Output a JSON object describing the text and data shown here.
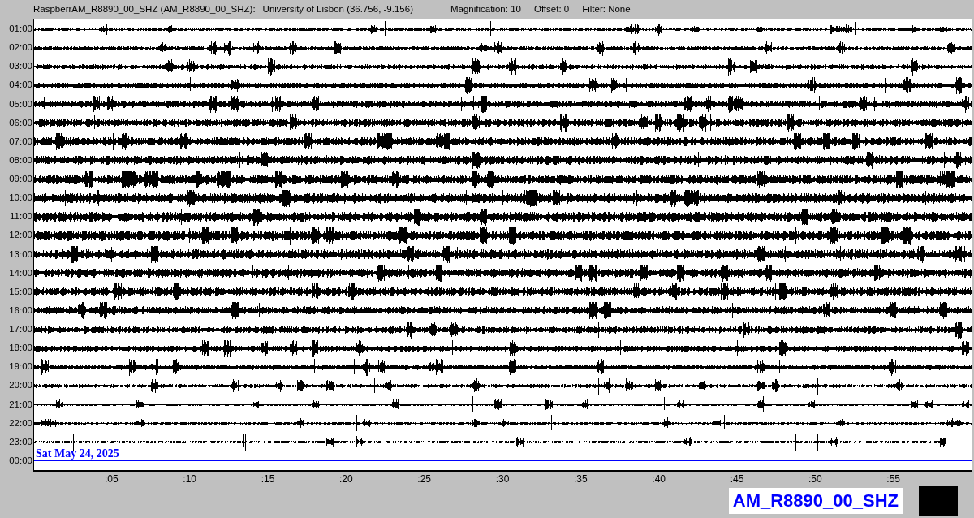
{
  "header": {
    "station": "RaspberrAM_R8890_00_SHZ (AM_R8890_00_SHZ):",
    "location": "University of Lisbon (36.756, -9.156)",
    "magnification": "Magnification: 10",
    "offset": "Offset: 0",
    "filter": "Filter: None"
  },
  "helicorder": {
    "rows": [
      {
        "time": "01:00",
        "kind": "full"
      },
      {
        "time": "02:00",
        "kind": "full"
      },
      {
        "time": "03:00",
        "kind": "full"
      },
      {
        "time": "04:00",
        "kind": "full"
      },
      {
        "time": "05:00",
        "kind": "full"
      },
      {
        "time": "06:00",
        "kind": "full"
      },
      {
        "time": "07:00",
        "kind": "full"
      },
      {
        "time": "08:00",
        "kind": "full"
      },
      {
        "time": "09:00",
        "kind": "full"
      },
      {
        "time": "10:00",
        "kind": "full"
      },
      {
        "time": "11:00",
        "kind": "full"
      },
      {
        "time": "12:00",
        "kind": "full"
      },
      {
        "time": "13:00",
        "kind": "full"
      },
      {
        "time": "14:00",
        "kind": "full"
      },
      {
        "time": "15:00",
        "kind": "full"
      },
      {
        "time": "16:00",
        "kind": "full"
      },
      {
        "time": "17:00",
        "kind": "full"
      },
      {
        "time": "18:00",
        "kind": "full"
      },
      {
        "time": "19:00",
        "kind": "full"
      },
      {
        "time": "20:00",
        "kind": "full"
      },
      {
        "time": "21:00",
        "kind": "full"
      },
      {
        "time": "22:00",
        "kind": "full"
      },
      {
        "time": "23:00",
        "kind": "partial"
      },
      {
        "time": "00:00",
        "kind": "empty"
      }
    ],
    "date_label": "Sat May 24, 2025",
    "x_ticks": [
      ":05",
      ":10",
      ":15",
      ":20",
      ":25",
      ":30",
      ":35",
      ":40",
      ":45",
      ":50",
      ":55"
    ]
  },
  "station_label": "AM_R8890_00_SHZ"
}
